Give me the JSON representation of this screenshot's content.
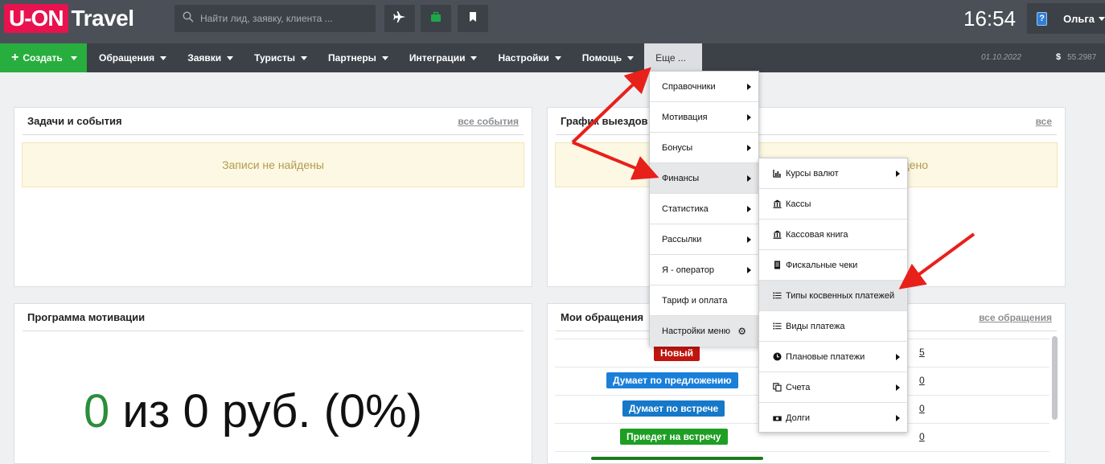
{
  "brand": {
    "box": "U-ON",
    "name": "Travel"
  },
  "search": {
    "placeholder": "Найти лид, заявку, клиента ..."
  },
  "clock": "16:54",
  "user": {
    "name": "Ольга"
  },
  "nav": {
    "create": "Создать",
    "items": [
      "Обращения",
      "Заявки",
      "Туристы",
      "Партнеры",
      "Интеграции",
      "Настройки",
      "Помощь"
    ],
    "more": "Еще ...",
    "date": "01.10.2022",
    "currency_symbol": "$",
    "rate": "55.2987"
  },
  "panels": {
    "tasks": {
      "title": "Задачи и события",
      "link": "все события",
      "empty": "Записи не найдены"
    },
    "schedule": {
      "title": "График выездов",
      "link": "все",
      "empty": "Записи не найдено"
    },
    "motivation": {
      "title": "Программа мотивации",
      "value": "0",
      "rest": "из 0 руб. (0%)"
    },
    "requests": {
      "title": "Мои обращения",
      "link": "все обращения",
      "rows": [
        {
          "label": "Новый",
          "count": "5",
          "color": "#c0160f"
        },
        {
          "label": "Думает по предложению",
          "count": "0",
          "color": "#1a7fd9"
        },
        {
          "label": "Думает по встрече",
          "count": "0",
          "color": "#1678c8"
        },
        {
          "label": "Приедет на встречу",
          "count": "0",
          "color": "#1f9e24"
        }
      ]
    }
  },
  "menu_more": [
    {
      "label": "Справочники",
      "arrow": true
    },
    {
      "label": "Мотивация",
      "arrow": true
    },
    {
      "label": "Бонусы",
      "arrow": true
    },
    {
      "label": "Финансы",
      "arrow": true,
      "active": true
    },
    {
      "label": "Статистика",
      "arrow": true
    },
    {
      "label": "Рассылки",
      "arrow": true
    },
    {
      "label": "Я - оператор",
      "arrow": true
    },
    {
      "label": "Тариф и оплата",
      "arrow": false
    },
    {
      "label": "Настройки меню",
      "arrow": false,
      "gear": true
    }
  ],
  "menu_finance": [
    {
      "label": "Курсы валют",
      "icon": "chart-icon",
      "arrow": true
    },
    {
      "label": "Кассы",
      "icon": "bank-icon",
      "arrow": false
    },
    {
      "label": "Кассовая книга",
      "icon": "bank-icon",
      "arrow": false
    },
    {
      "label": "Фискальные чеки",
      "icon": "receipt-icon",
      "arrow": false
    },
    {
      "label": "Типы косвенных платежей",
      "icon": "list-icon",
      "arrow": false,
      "active": true
    },
    {
      "label": "Виды платежа",
      "icon": "list-icon",
      "arrow": false
    },
    {
      "label": "Плановые платежи",
      "icon": "clock-icon",
      "arrow": true
    },
    {
      "label": "Счета",
      "icon": "copy-icon",
      "arrow": true
    },
    {
      "label": "Долги",
      "icon": "money-icon",
      "arrow": true
    }
  ],
  "colors": {
    "accent_green": "#27ae3e",
    "brand_pink": "#e8124f",
    "annotation_red": "#e8201a"
  }
}
